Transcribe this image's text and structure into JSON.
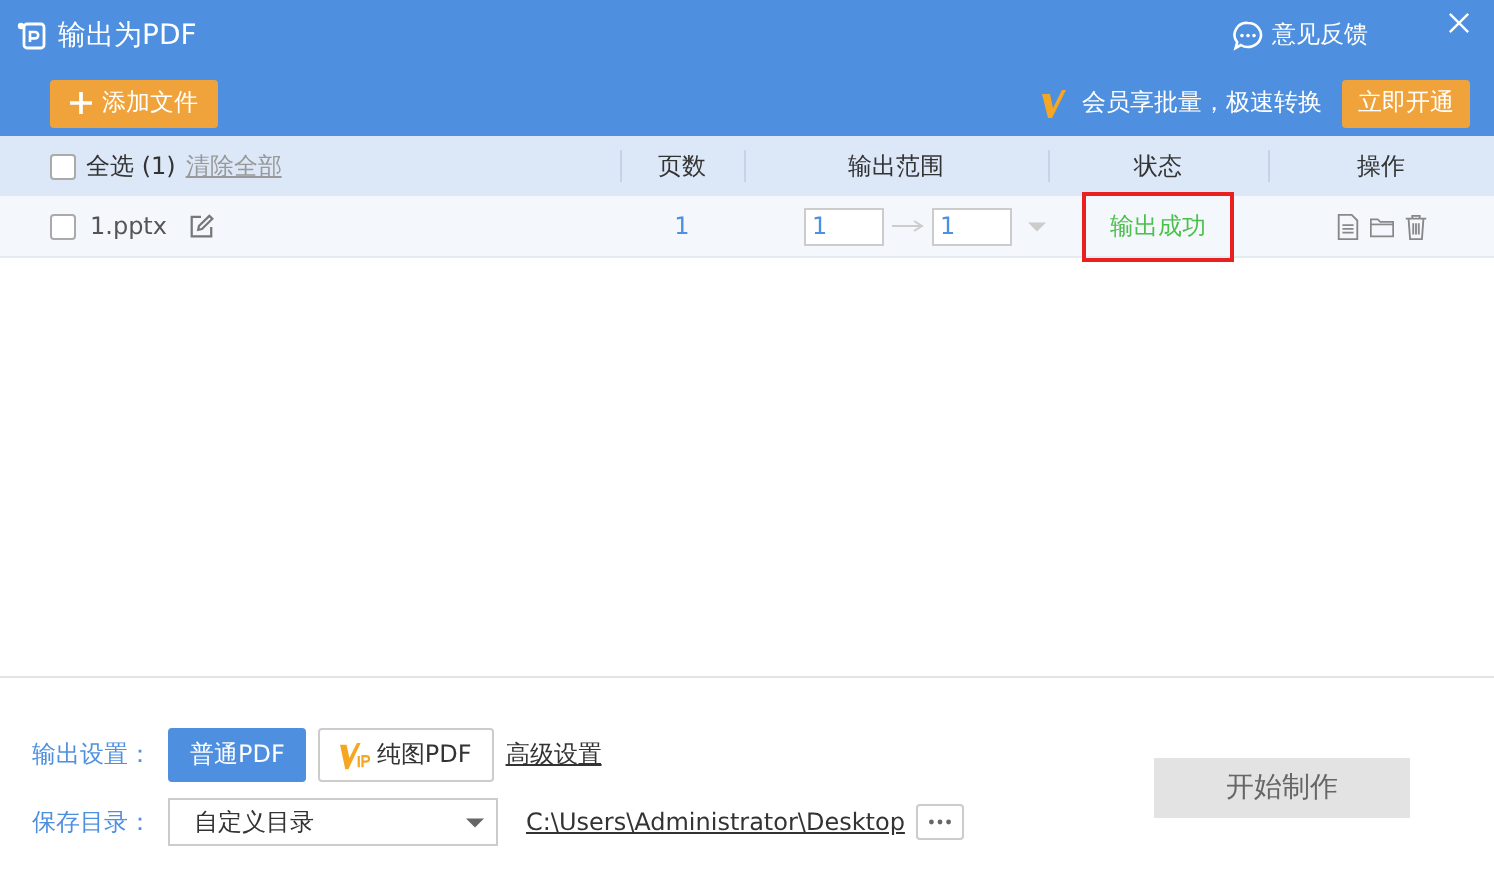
{
  "window": {
    "title": "输出为PDF",
    "feedback": "意见反馈"
  },
  "toolbar": {
    "add_button": "添加文件",
    "promo": "会员享批量，极速转换",
    "upgrade_button": "立即开通"
  },
  "table": {
    "select_all": {
      "label": "全选 (1)",
      "checked": false
    },
    "clear_all": "清除全部",
    "columns": [
      "页数",
      "输出范围",
      "状态",
      "操作"
    ],
    "rows": [
      {
        "name": "1.pptx",
        "checked": false,
        "pages": "1",
        "range_from": "1",
        "range_to": "1",
        "status": "输出成功",
        "highlighted": true
      }
    ]
  },
  "settings": {
    "output_label": "输出设置：",
    "modes": [
      {
        "label": "普通PDF",
        "selected": true,
        "vip": false
      },
      {
        "label": "纯图PDF",
        "selected": false,
        "vip": true
      }
    ],
    "advanced": "高级设置",
    "save_label": "保存目录：",
    "save_dir": "自定义目录",
    "path": "C:\\Users\\Administrator\\Desktop"
  },
  "start_button": {
    "label": "开始制作",
    "disabled": true
  }
}
